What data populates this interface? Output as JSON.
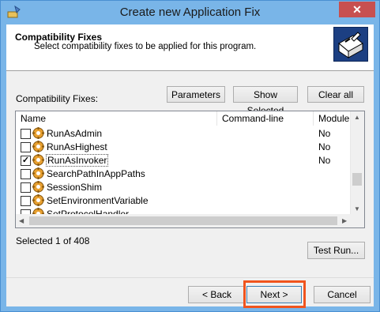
{
  "window": {
    "title": "Create new Application Fix",
    "close_glyph": "✕"
  },
  "header": {
    "title": "Compatibility Fixes",
    "subtitle": "Select compatibility fixes to be applied for this program."
  },
  "fixes_label": "Compatibility Fixes:",
  "buttons": {
    "parameters": "Parameters",
    "show_selected": "Show Selected",
    "clear_all": "Clear all",
    "test_run": "Test Run...",
    "back": "< Back",
    "next": "Next >",
    "cancel": "Cancel"
  },
  "columns": [
    "Name",
    "Command-line",
    "Module"
  ],
  "rows": [
    {
      "name": "RunAsAdmin",
      "checked": false,
      "module": "No"
    },
    {
      "name": "RunAsHighest",
      "checked": false,
      "module": "No"
    },
    {
      "name": "RunAsInvoker",
      "checked": true,
      "module": "No"
    },
    {
      "name": "SearchPathInAppPaths",
      "checked": false,
      "module": ""
    },
    {
      "name": "SessionShim",
      "checked": false,
      "module": ""
    },
    {
      "name": "SetEnvironmentVariable",
      "checked": false,
      "module": ""
    },
    {
      "name": "SetProtocolHandler",
      "checked": false,
      "module": ""
    }
  ],
  "status": "Selected 1 of 408",
  "colors": {
    "title_bar": "#79b5e8",
    "close_button": "#c75050",
    "highlight": "#f0541e"
  }
}
